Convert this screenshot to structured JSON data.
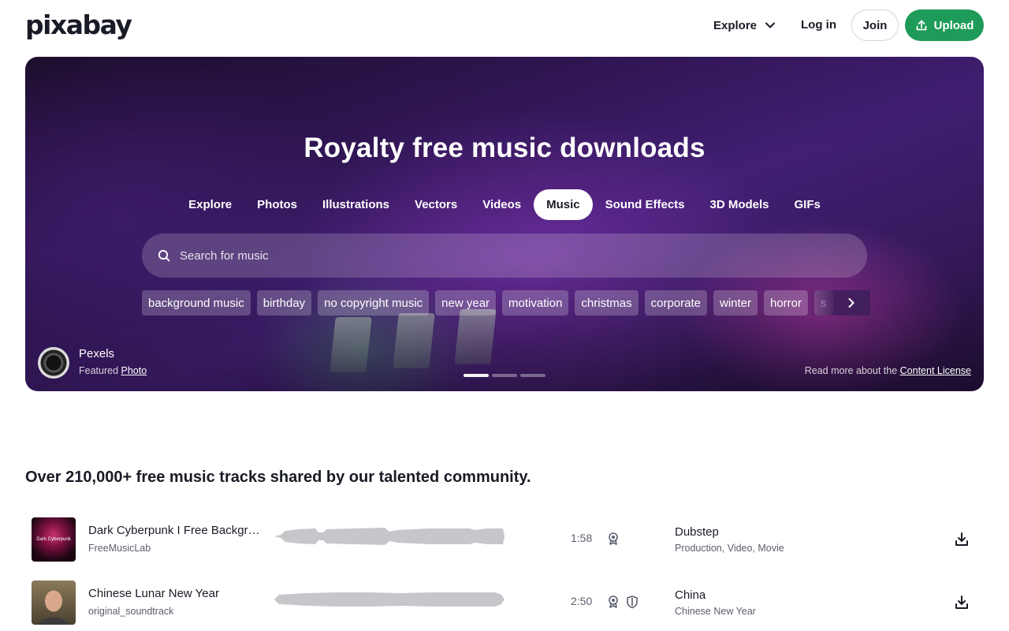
{
  "header": {
    "logo": "pixabay",
    "explore": "Explore",
    "login": "Log in",
    "join": "Join",
    "upload": "Upload"
  },
  "hero": {
    "title": "Royalty free music downloads",
    "tabs": [
      "Explore",
      "Photos",
      "Illustrations",
      "Vectors",
      "Videos",
      "Music",
      "Sound Effects",
      "3D Models",
      "GIFs"
    ],
    "active_tab": "Music",
    "search_placeholder": "Search for music",
    "chips": [
      "background music",
      "birthday",
      "no copyright music",
      "new year",
      "motivation",
      "christmas",
      "corporate",
      "winter",
      "horror",
      "s"
    ],
    "credit_name": "Pexels",
    "credit_prefix": "Featured",
    "credit_link": "Photo",
    "license_prefix": "Read more about the",
    "license_link": "Content License",
    "slide_count": 3,
    "active_slide": 1
  },
  "section": {
    "title": "Over 210,000+ free music tracks shared by our talented community."
  },
  "tracks": [
    {
      "title": "Dark Cyberpunk I Free Backgro...",
      "thumb_text": "Dark Cyberpunk",
      "artist": "FreeMusicLab",
      "duration": "1:58",
      "genre": "Dubstep",
      "tags": "Production, Video, Movie",
      "badges": [
        "award-icon"
      ]
    },
    {
      "title": "Chinese Lunar New Year",
      "artist": "original_soundtrack",
      "duration": "2:50",
      "genre": "China",
      "tags": "Chinese New Year",
      "badges": [
        "award-icon",
        "shield-icon"
      ]
    }
  ],
  "colors": {
    "accent": "#1e9b58",
    "text": "#191b26",
    "muted": "#5b5e6d"
  }
}
